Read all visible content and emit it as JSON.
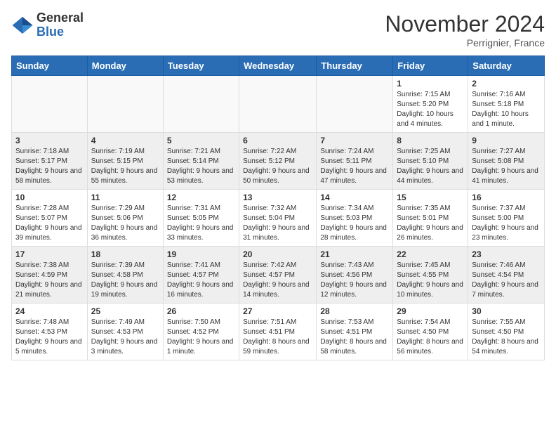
{
  "logo": {
    "general": "General",
    "blue": "Blue"
  },
  "header": {
    "month": "November 2024",
    "location": "Perrignier, France"
  },
  "weekdays": [
    "Sunday",
    "Monday",
    "Tuesday",
    "Wednesday",
    "Thursday",
    "Friday",
    "Saturday"
  ],
  "weeks": [
    [
      {
        "day": "",
        "info": ""
      },
      {
        "day": "",
        "info": ""
      },
      {
        "day": "",
        "info": ""
      },
      {
        "day": "",
        "info": ""
      },
      {
        "day": "",
        "info": ""
      },
      {
        "day": "1",
        "info": "Sunrise: 7:15 AM\nSunset: 5:20 PM\nDaylight: 10 hours and 4 minutes."
      },
      {
        "day": "2",
        "info": "Sunrise: 7:16 AM\nSunset: 5:18 PM\nDaylight: 10 hours and 1 minute."
      }
    ],
    [
      {
        "day": "3",
        "info": "Sunrise: 7:18 AM\nSunset: 5:17 PM\nDaylight: 9 hours and 58 minutes."
      },
      {
        "day": "4",
        "info": "Sunrise: 7:19 AM\nSunset: 5:15 PM\nDaylight: 9 hours and 55 minutes."
      },
      {
        "day": "5",
        "info": "Sunrise: 7:21 AM\nSunset: 5:14 PM\nDaylight: 9 hours and 53 minutes."
      },
      {
        "day": "6",
        "info": "Sunrise: 7:22 AM\nSunset: 5:12 PM\nDaylight: 9 hours and 50 minutes."
      },
      {
        "day": "7",
        "info": "Sunrise: 7:24 AM\nSunset: 5:11 PM\nDaylight: 9 hours and 47 minutes."
      },
      {
        "day": "8",
        "info": "Sunrise: 7:25 AM\nSunset: 5:10 PM\nDaylight: 9 hours and 44 minutes."
      },
      {
        "day": "9",
        "info": "Sunrise: 7:27 AM\nSunset: 5:08 PM\nDaylight: 9 hours and 41 minutes."
      }
    ],
    [
      {
        "day": "10",
        "info": "Sunrise: 7:28 AM\nSunset: 5:07 PM\nDaylight: 9 hours and 39 minutes."
      },
      {
        "day": "11",
        "info": "Sunrise: 7:29 AM\nSunset: 5:06 PM\nDaylight: 9 hours and 36 minutes."
      },
      {
        "day": "12",
        "info": "Sunrise: 7:31 AM\nSunset: 5:05 PM\nDaylight: 9 hours and 33 minutes."
      },
      {
        "day": "13",
        "info": "Sunrise: 7:32 AM\nSunset: 5:04 PM\nDaylight: 9 hours and 31 minutes."
      },
      {
        "day": "14",
        "info": "Sunrise: 7:34 AM\nSunset: 5:03 PM\nDaylight: 9 hours and 28 minutes."
      },
      {
        "day": "15",
        "info": "Sunrise: 7:35 AM\nSunset: 5:01 PM\nDaylight: 9 hours and 26 minutes."
      },
      {
        "day": "16",
        "info": "Sunrise: 7:37 AM\nSunset: 5:00 PM\nDaylight: 9 hours and 23 minutes."
      }
    ],
    [
      {
        "day": "17",
        "info": "Sunrise: 7:38 AM\nSunset: 4:59 PM\nDaylight: 9 hours and 21 minutes."
      },
      {
        "day": "18",
        "info": "Sunrise: 7:39 AM\nSunset: 4:58 PM\nDaylight: 9 hours and 19 minutes."
      },
      {
        "day": "19",
        "info": "Sunrise: 7:41 AM\nSunset: 4:57 PM\nDaylight: 9 hours and 16 minutes."
      },
      {
        "day": "20",
        "info": "Sunrise: 7:42 AM\nSunset: 4:57 PM\nDaylight: 9 hours and 14 minutes."
      },
      {
        "day": "21",
        "info": "Sunrise: 7:43 AM\nSunset: 4:56 PM\nDaylight: 9 hours and 12 minutes."
      },
      {
        "day": "22",
        "info": "Sunrise: 7:45 AM\nSunset: 4:55 PM\nDaylight: 9 hours and 10 minutes."
      },
      {
        "day": "23",
        "info": "Sunrise: 7:46 AM\nSunset: 4:54 PM\nDaylight: 9 hours and 7 minutes."
      }
    ],
    [
      {
        "day": "24",
        "info": "Sunrise: 7:48 AM\nSunset: 4:53 PM\nDaylight: 9 hours and 5 minutes."
      },
      {
        "day": "25",
        "info": "Sunrise: 7:49 AM\nSunset: 4:53 PM\nDaylight: 9 hours and 3 minutes."
      },
      {
        "day": "26",
        "info": "Sunrise: 7:50 AM\nSunset: 4:52 PM\nDaylight: 9 hours and 1 minute."
      },
      {
        "day": "27",
        "info": "Sunrise: 7:51 AM\nSunset: 4:51 PM\nDaylight: 8 hours and 59 minutes."
      },
      {
        "day": "28",
        "info": "Sunrise: 7:53 AM\nSunset: 4:51 PM\nDaylight: 8 hours and 58 minutes."
      },
      {
        "day": "29",
        "info": "Sunrise: 7:54 AM\nSunset: 4:50 PM\nDaylight: 8 hours and 56 minutes."
      },
      {
        "day": "30",
        "info": "Sunrise: 7:55 AM\nSunset: 4:50 PM\nDaylight: 8 hours and 54 minutes."
      }
    ]
  ]
}
